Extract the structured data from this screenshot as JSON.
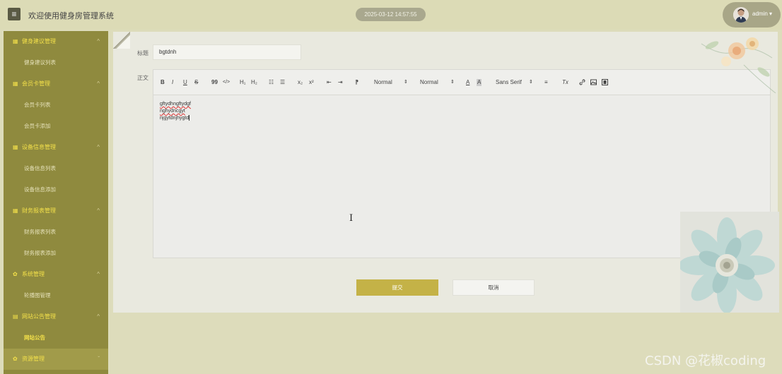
{
  "header": {
    "title": "欢迎使用健身房管理系统",
    "datetime": "2025-03-12 14:57:55",
    "user": "admin",
    "user_caret": "▾"
  },
  "sidebar": {
    "groups": [
      {
        "label": "健身建议管理",
        "items": [
          "健身建议列表"
        ]
      },
      {
        "label": "会员卡管理",
        "items": [
          "会员卡列表",
          "会员卡添加"
        ]
      },
      {
        "label": "设备信息管理",
        "items": [
          "设备信息列表",
          "设备信息添加"
        ]
      },
      {
        "label": "财务报表管理",
        "items": [
          "财务报表列表",
          "财务报表添加"
        ]
      },
      {
        "label": "系统管理",
        "items": [
          "轮播图管理"
        ]
      },
      {
        "label": "网站公告管理",
        "items": [
          "网站公告"
        ]
      },
      {
        "label": "资源管理",
        "items": []
      }
    ],
    "active_item": "网站公告",
    "chevron_up": "^",
    "chevron_down": "ˇ"
  },
  "form": {
    "title_label": "标题",
    "title_value": "bgtdnh",
    "body_label": "正文",
    "body_lines": [
      "gftydhngftydgf",
      "nghydncgyt",
      "njgytdnjhygtd"
    ],
    "submit_label": "提交",
    "cancel_label": "取消"
  },
  "toolbar": {
    "bold": "B",
    "italic": "I",
    "underline": "U",
    "strike": "S",
    "quote": "99",
    "code": "</>",
    "h1": "H₁",
    "h2": "H₂",
    "ordered_list": "☷",
    "bullet_list": "☰",
    "subscript": "x₂",
    "superscript": "x²",
    "outdent": "⇤",
    "indent": "⇥",
    "direction": "⁋",
    "size_select": "Normal",
    "header_select": "Normal",
    "font_color": "A",
    "bg_color": "A",
    "font_select": "Sans Serif",
    "align": "≡",
    "clean": "Tx",
    "select_arrows": "⇕"
  },
  "watermark": "CSDN @花椒coding",
  "colors": {
    "sidebar_bg": "#8f8a3e",
    "accent": "#f3e04a",
    "submit_bg": "#c4b247"
  }
}
